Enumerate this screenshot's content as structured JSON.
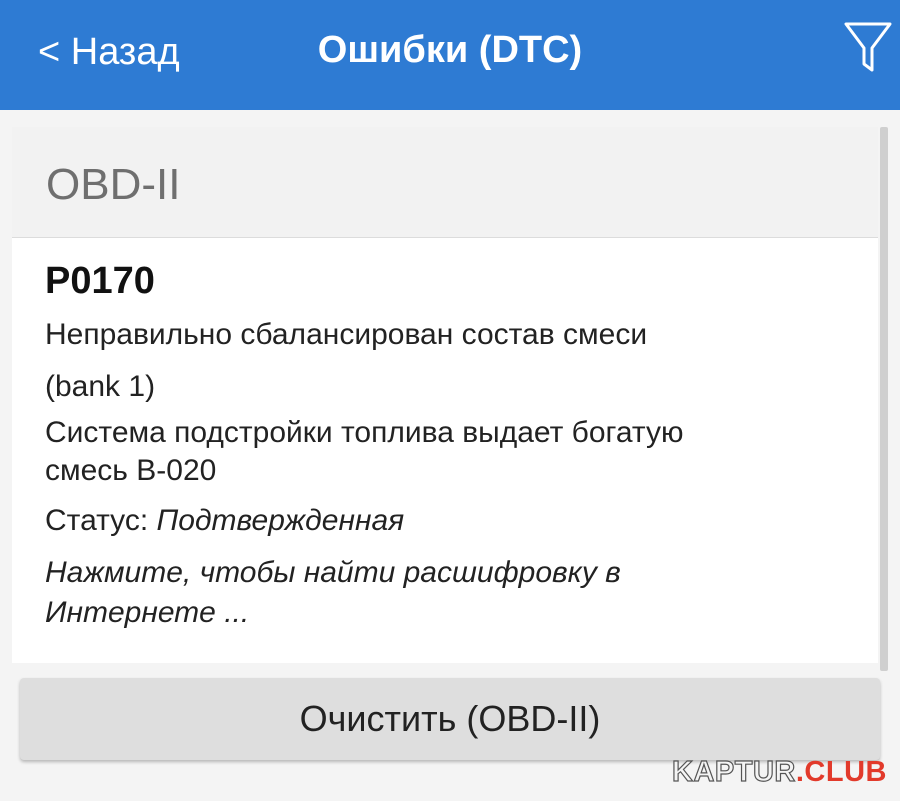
{
  "appbar": {
    "back_label": "< Назад",
    "title": "Ошибки (DTC)",
    "filter_icon": "filter-funnel-icon",
    "background_color": "#2e7bd3"
  },
  "section": {
    "header": "OBD-II"
  },
  "dtc": {
    "code": "P0170",
    "description_line1": "Неправильно сбалансирован состав смеси",
    "description_line2": "(bank 1)",
    "detail_line1": "Система подстройки топлива выдает богатую",
    "detail_line2": "смесь B-020",
    "status_label": "Статус: ",
    "status_value": "Подтвержденная",
    "search_hint_line1": "Нажмите, чтобы найти расшифровку в",
    "search_hint_line2": "Интернете ..."
  },
  "actions": {
    "clear_label": "Очистить (OBD-II)"
  },
  "watermark": {
    "part1": "KAPTUR",
    "dot": ".",
    "part2": "CLUB"
  }
}
